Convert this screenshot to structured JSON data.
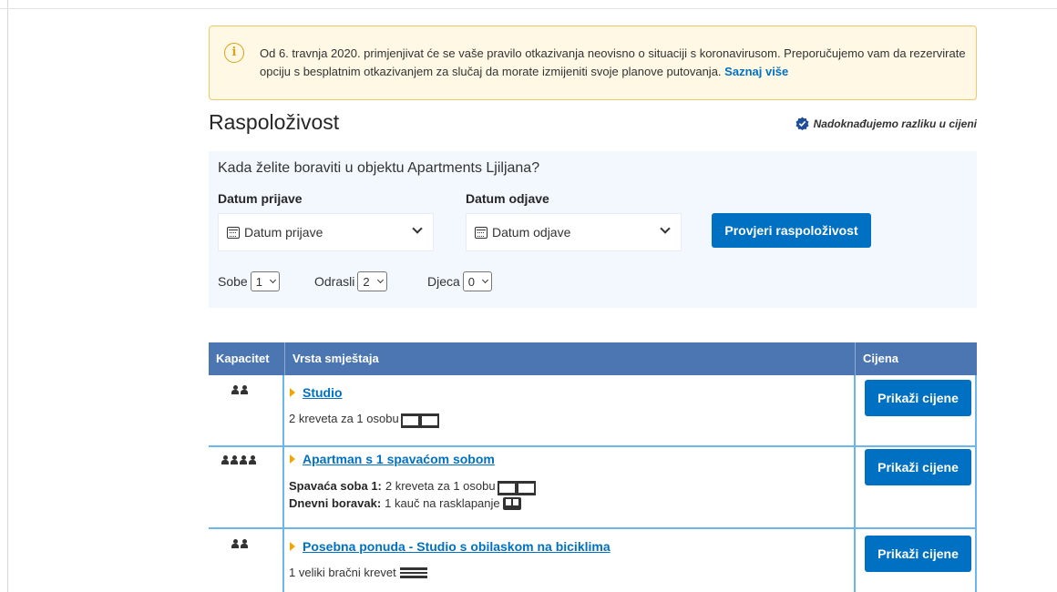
{
  "notice": {
    "text": "Od 6. travnja 2020. primjenjivat će se vaše pravilo otkazivanja neovisno o situaciji s koronavirusom. Preporučujemo vam da rezervirate opciju s besplatnim otkazivanjem za slučaj da morate izmijeniti svoje planove putovanja.",
    "link": "Saznaj više"
  },
  "title": "Raspoloživost",
  "price_match": "Nadoknađujemo razliku u cijeni",
  "search": {
    "question": "Kada želite boraviti u objektu Apartments Ljiljana?",
    "checkin_label": "Datum prijave",
    "checkin_placeholder": "Datum prijave",
    "checkout_label": "Datum odjave",
    "checkout_placeholder": "Datum odjave",
    "button": "Provjeri raspoloživost",
    "rooms_label": "Sobe",
    "rooms_value": "1",
    "adults_label": "Odrasli",
    "adults_value": "2",
    "children_label": "Djeca",
    "children_value": "0"
  },
  "table": {
    "headers": {
      "capacity": "Kapacitet",
      "type": "Vrsta smještaja",
      "price": "Cijena"
    },
    "rows": [
      {
        "capacity": 2,
        "name": "Studio",
        "beds": [
          {
            "label": "",
            "text": "2 kreveta za 1 osobu",
            "icon": "single-beds-icon"
          }
        ],
        "button": "Prikaži cijene"
      },
      {
        "capacity": 4,
        "name": "Apartman s 1 spavaćom sobom",
        "beds": [
          {
            "label": "Spavaća soba 1:",
            "text": "2 kreveta za 1 osobu",
            "icon": "single-beds-icon"
          },
          {
            "label": "Dnevni boravak:",
            "text": "1 kauč na rasklapanje",
            "icon": "sofa-bed-icon"
          }
        ],
        "button": "Prikaži cijene"
      },
      {
        "capacity": 2,
        "name": "Posebna ponuda - Studio s obilaskom na biciklima",
        "beds": [
          {
            "label": "",
            "text": "1 veliki bračni krevet",
            "icon": "double-bed-icon"
          }
        ],
        "button": "Prikaži cijene"
      }
    ]
  },
  "colors": {
    "accent": "#0071c2",
    "table_header": "#4c76b2",
    "notice_bg": "#fef8e4",
    "search_bg": "#f2f8fd"
  }
}
